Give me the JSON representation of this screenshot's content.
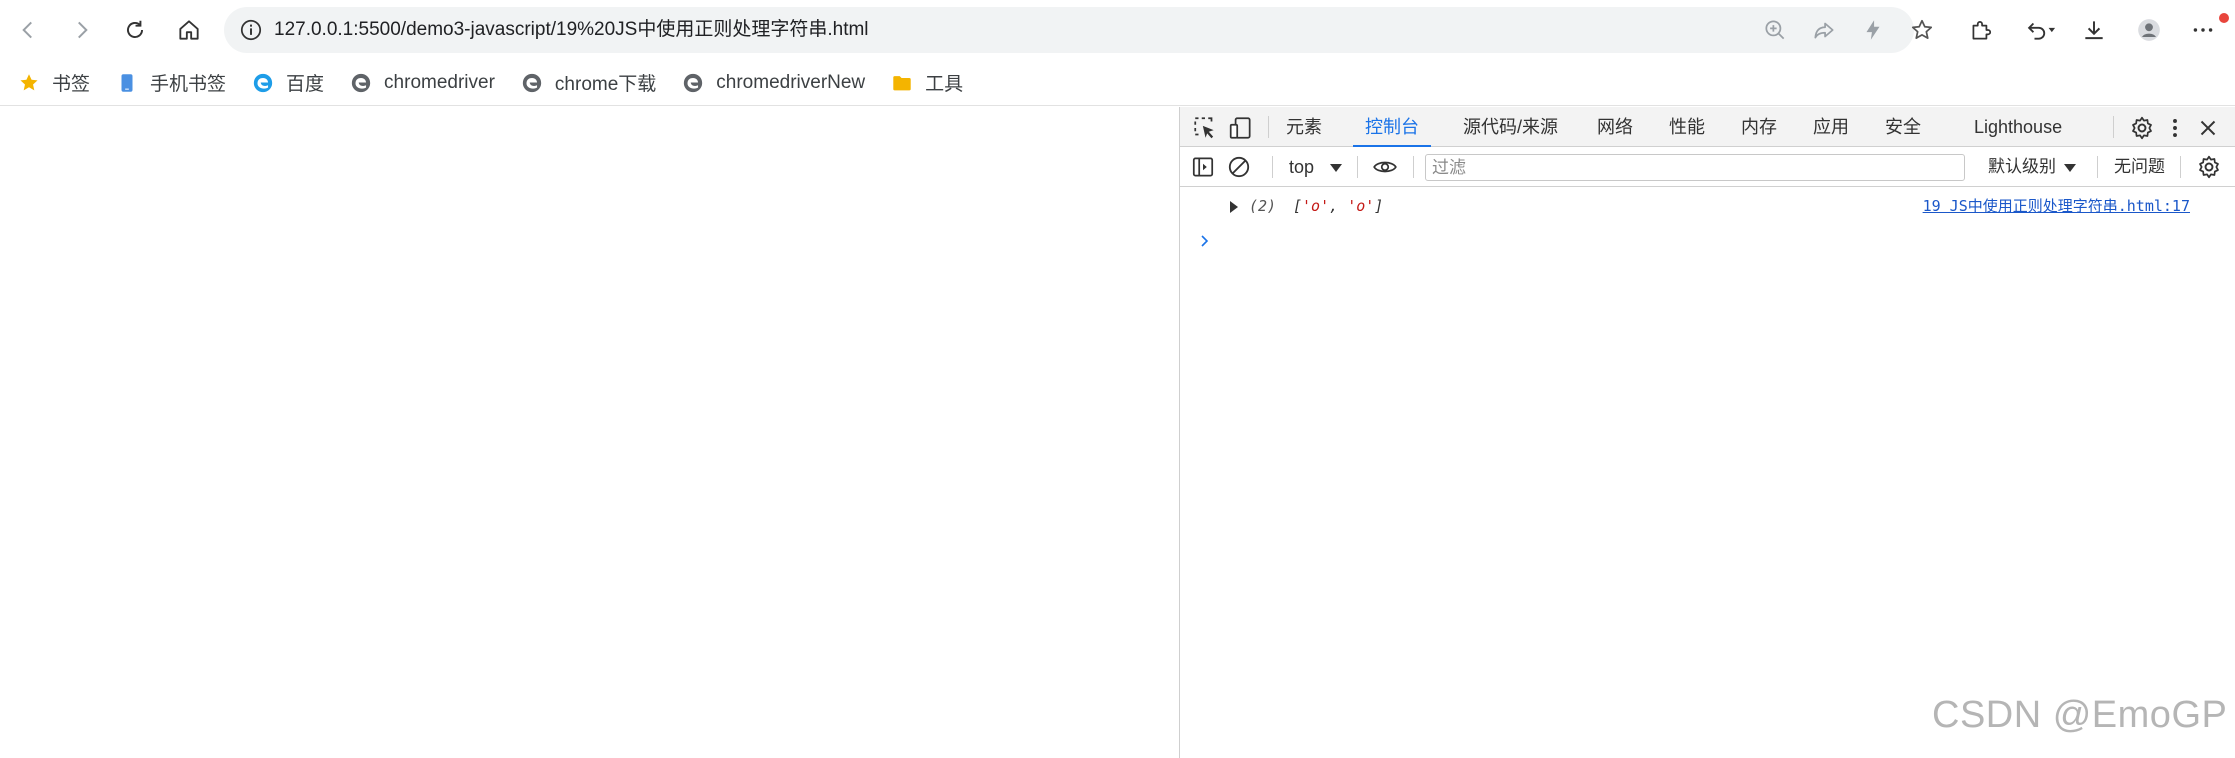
{
  "toolbar": {
    "url": "127.0.0.1:5500/demo3-javascript/19%20JS中使用正则处理字符串.html"
  },
  "bookmarks": [
    {
      "label": "书签",
      "icon": "star-icon",
      "color": "#f4b400"
    },
    {
      "label": "手机书签",
      "icon": "mobile-icon",
      "color": "#4a90e2"
    },
    {
      "label": "百度",
      "icon": "edge-icon",
      "color": "#1e9de8"
    },
    {
      "label": "chromedriver",
      "icon": "globe-icon",
      "color": "#5f6368"
    },
    {
      "label": "chrome下载",
      "icon": "globe-icon",
      "color": "#5f6368"
    },
    {
      "label": "chromedriverNew",
      "icon": "globe-icon",
      "color": "#5f6368"
    },
    {
      "label": "工具",
      "icon": "folder-icon",
      "color": "#f4b400"
    }
  ],
  "devtools": {
    "tabs": [
      {
        "label": "元素",
        "active": false
      },
      {
        "label": "控制台",
        "active": true
      },
      {
        "label": "源代码/来源",
        "active": false
      },
      {
        "label": "网络",
        "active": false
      },
      {
        "label": "性能",
        "active": false
      },
      {
        "label": "内存",
        "active": false
      },
      {
        "label": "应用",
        "active": false
      },
      {
        "label": "安全",
        "active": false
      },
      {
        "label": "Lighthouse",
        "active": false
      }
    ],
    "context": "top",
    "filter_placeholder": "过滤",
    "log_level": "默认级别",
    "issues": "无问题",
    "console": {
      "count": "(2)",
      "array_open": "[",
      "item1": "'o'",
      "sep": ", ",
      "item2": "'o'",
      "array_close": "]",
      "source": "19 JS中使用正则处理字符串.html:17"
    },
    "accent_color": "#1a73e8"
  },
  "watermark": "CSDN @EmoGP"
}
